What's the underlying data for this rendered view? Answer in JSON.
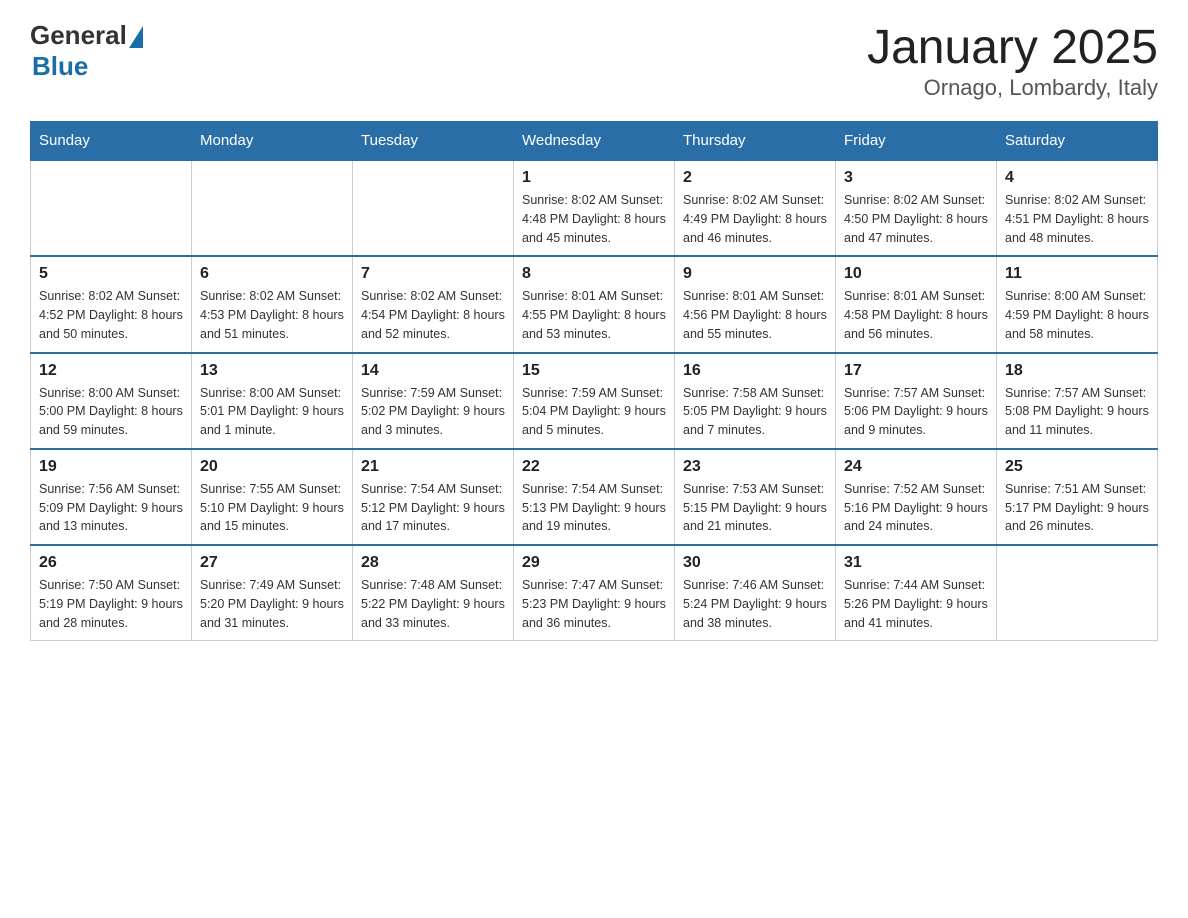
{
  "header": {
    "logo_general": "General",
    "logo_blue": "Blue",
    "title": "January 2025",
    "subtitle": "Ornago, Lombardy, Italy"
  },
  "days_of_week": [
    "Sunday",
    "Monday",
    "Tuesday",
    "Wednesday",
    "Thursday",
    "Friday",
    "Saturday"
  ],
  "weeks": [
    [
      {
        "day": "",
        "info": ""
      },
      {
        "day": "",
        "info": ""
      },
      {
        "day": "",
        "info": ""
      },
      {
        "day": "1",
        "info": "Sunrise: 8:02 AM\nSunset: 4:48 PM\nDaylight: 8 hours\nand 45 minutes."
      },
      {
        "day": "2",
        "info": "Sunrise: 8:02 AM\nSunset: 4:49 PM\nDaylight: 8 hours\nand 46 minutes."
      },
      {
        "day": "3",
        "info": "Sunrise: 8:02 AM\nSunset: 4:50 PM\nDaylight: 8 hours\nand 47 minutes."
      },
      {
        "day": "4",
        "info": "Sunrise: 8:02 AM\nSunset: 4:51 PM\nDaylight: 8 hours\nand 48 minutes."
      }
    ],
    [
      {
        "day": "5",
        "info": "Sunrise: 8:02 AM\nSunset: 4:52 PM\nDaylight: 8 hours\nand 50 minutes."
      },
      {
        "day": "6",
        "info": "Sunrise: 8:02 AM\nSunset: 4:53 PM\nDaylight: 8 hours\nand 51 minutes."
      },
      {
        "day": "7",
        "info": "Sunrise: 8:02 AM\nSunset: 4:54 PM\nDaylight: 8 hours\nand 52 minutes."
      },
      {
        "day": "8",
        "info": "Sunrise: 8:01 AM\nSunset: 4:55 PM\nDaylight: 8 hours\nand 53 minutes."
      },
      {
        "day": "9",
        "info": "Sunrise: 8:01 AM\nSunset: 4:56 PM\nDaylight: 8 hours\nand 55 minutes."
      },
      {
        "day": "10",
        "info": "Sunrise: 8:01 AM\nSunset: 4:58 PM\nDaylight: 8 hours\nand 56 minutes."
      },
      {
        "day": "11",
        "info": "Sunrise: 8:00 AM\nSunset: 4:59 PM\nDaylight: 8 hours\nand 58 minutes."
      }
    ],
    [
      {
        "day": "12",
        "info": "Sunrise: 8:00 AM\nSunset: 5:00 PM\nDaylight: 8 hours\nand 59 minutes."
      },
      {
        "day": "13",
        "info": "Sunrise: 8:00 AM\nSunset: 5:01 PM\nDaylight: 9 hours\nand 1 minute."
      },
      {
        "day": "14",
        "info": "Sunrise: 7:59 AM\nSunset: 5:02 PM\nDaylight: 9 hours\nand 3 minutes."
      },
      {
        "day": "15",
        "info": "Sunrise: 7:59 AM\nSunset: 5:04 PM\nDaylight: 9 hours\nand 5 minutes."
      },
      {
        "day": "16",
        "info": "Sunrise: 7:58 AM\nSunset: 5:05 PM\nDaylight: 9 hours\nand 7 minutes."
      },
      {
        "day": "17",
        "info": "Sunrise: 7:57 AM\nSunset: 5:06 PM\nDaylight: 9 hours\nand 9 minutes."
      },
      {
        "day": "18",
        "info": "Sunrise: 7:57 AM\nSunset: 5:08 PM\nDaylight: 9 hours\nand 11 minutes."
      }
    ],
    [
      {
        "day": "19",
        "info": "Sunrise: 7:56 AM\nSunset: 5:09 PM\nDaylight: 9 hours\nand 13 minutes."
      },
      {
        "day": "20",
        "info": "Sunrise: 7:55 AM\nSunset: 5:10 PM\nDaylight: 9 hours\nand 15 minutes."
      },
      {
        "day": "21",
        "info": "Sunrise: 7:54 AM\nSunset: 5:12 PM\nDaylight: 9 hours\nand 17 minutes."
      },
      {
        "day": "22",
        "info": "Sunrise: 7:54 AM\nSunset: 5:13 PM\nDaylight: 9 hours\nand 19 minutes."
      },
      {
        "day": "23",
        "info": "Sunrise: 7:53 AM\nSunset: 5:15 PM\nDaylight: 9 hours\nand 21 minutes."
      },
      {
        "day": "24",
        "info": "Sunrise: 7:52 AM\nSunset: 5:16 PM\nDaylight: 9 hours\nand 24 minutes."
      },
      {
        "day": "25",
        "info": "Sunrise: 7:51 AM\nSunset: 5:17 PM\nDaylight: 9 hours\nand 26 minutes."
      }
    ],
    [
      {
        "day": "26",
        "info": "Sunrise: 7:50 AM\nSunset: 5:19 PM\nDaylight: 9 hours\nand 28 minutes."
      },
      {
        "day": "27",
        "info": "Sunrise: 7:49 AM\nSunset: 5:20 PM\nDaylight: 9 hours\nand 31 minutes."
      },
      {
        "day": "28",
        "info": "Sunrise: 7:48 AM\nSunset: 5:22 PM\nDaylight: 9 hours\nand 33 minutes."
      },
      {
        "day": "29",
        "info": "Sunrise: 7:47 AM\nSunset: 5:23 PM\nDaylight: 9 hours\nand 36 minutes."
      },
      {
        "day": "30",
        "info": "Sunrise: 7:46 AM\nSunset: 5:24 PM\nDaylight: 9 hours\nand 38 minutes."
      },
      {
        "day": "31",
        "info": "Sunrise: 7:44 AM\nSunset: 5:26 PM\nDaylight: 9 hours\nand 41 minutes."
      },
      {
        "day": "",
        "info": ""
      }
    ]
  ]
}
